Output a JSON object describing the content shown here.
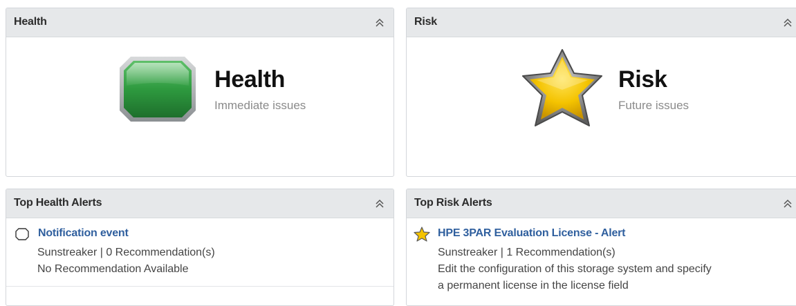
{
  "health_panel": {
    "header_title": "Health",
    "big_title": "Health",
    "subtitle": "Immediate issues",
    "icon": "green-octagon-icon",
    "color": "#2f8f45"
  },
  "risk_panel": {
    "header_title": "Risk",
    "big_title": "Risk",
    "subtitle": "Future issues",
    "icon": "yellow-star-icon",
    "color": "#f2c200"
  },
  "top_health_alerts": {
    "header_title": "Top Health Alerts",
    "items": [
      {
        "title": "Notification event",
        "icon": "notification-outline-icon",
        "meta": "Sunstreaker | 0 Recommendation(s)",
        "description_lines": [
          "No Recommendation Available"
        ]
      }
    ]
  },
  "top_risk_alerts": {
    "header_title": "Top Risk Alerts",
    "items": [
      {
        "title": "HPE 3PAR Evaluation License - Alert",
        "icon": "small-star-icon",
        "meta": "Sunstreaker | 1 Recommendation(s)",
        "description_lines": [
          "Edit the configuration of this storage system and specify",
          "a permanent license in the license field"
        ]
      }
    ]
  },
  "icons": {
    "collapse": "double-chevron-up-icon"
  },
  "colors": {
    "link": "#2f5f9e",
    "header_bg": "#e6e8ea"
  }
}
